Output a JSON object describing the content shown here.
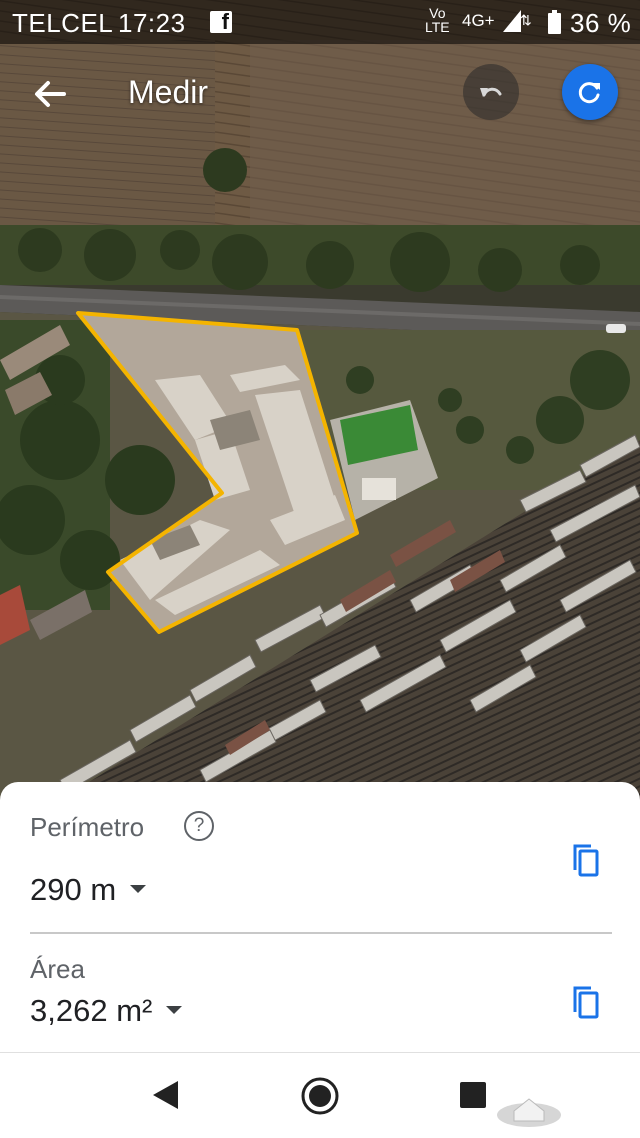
{
  "status_bar": {
    "carrier": "TELCEL",
    "time": "17:23",
    "app_notification_icon": "facebook-icon",
    "volte_top": "Vo",
    "volte_bottom": "LTE",
    "network": "4G+",
    "battery": "36 %"
  },
  "toolbar": {
    "title": "Medir",
    "back_icon": "arrow-back-icon",
    "undo_icon": "undo-icon",
    "refresh_icon": "refresh-icon"
  },
  "measure": {
    "perimeter_label": "Perímetro",
    "perimeter_value": "290 m",
    "area_label": "Área",
    "area_value": "3,262 m²"
  },
  "colors": {
    "outline": "#f4b400",
    "accent": "#1a73e8"
  }
}
